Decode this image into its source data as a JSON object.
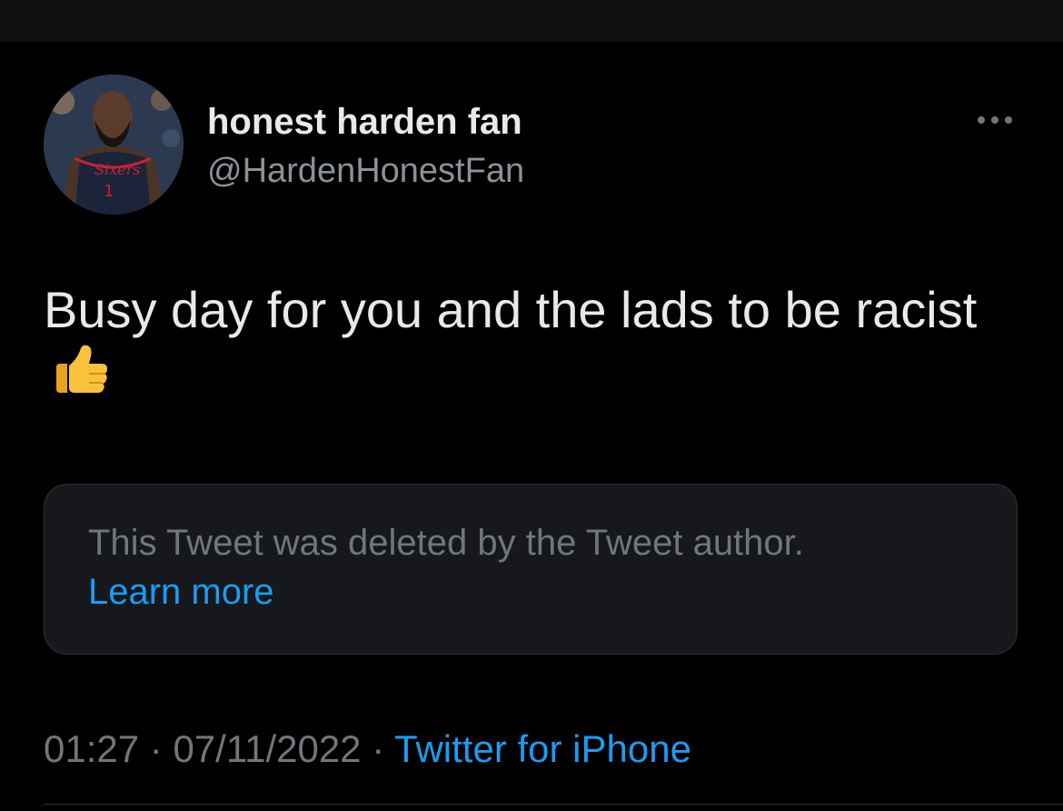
{
  "tweet": {
    "author": {
      "display_name": "honest harden fan",
      "handle": "@HardenHonestFan",
      "avatar": {
        "jersey_text": "Sixers",
        "jersey_number": "1"
      }
    },
    "more_icon": "ellipsis-icon",
    "text": "Busy day for you and the lads to be racist",
    "emoji": "thumbs-up-icon",
    "quoted": {
      "notice": "This Tweet was deleted by the Tweet author.",
      "learn_more": "Learn more"
    },
    "time": "01:27",
    "date": "07/11/2022",
    "separator": "·",
    "source": "Twitter for iPhone"
  },
  "colors": {
    "background": "#000000",
    "primary_text": "#e7e9ea",
    "secondary_text": "#71767b",
    "link": "#1d9bf0",
    "card_background": "#16181b",
    "card_border": "#2f3336"
  }
}
